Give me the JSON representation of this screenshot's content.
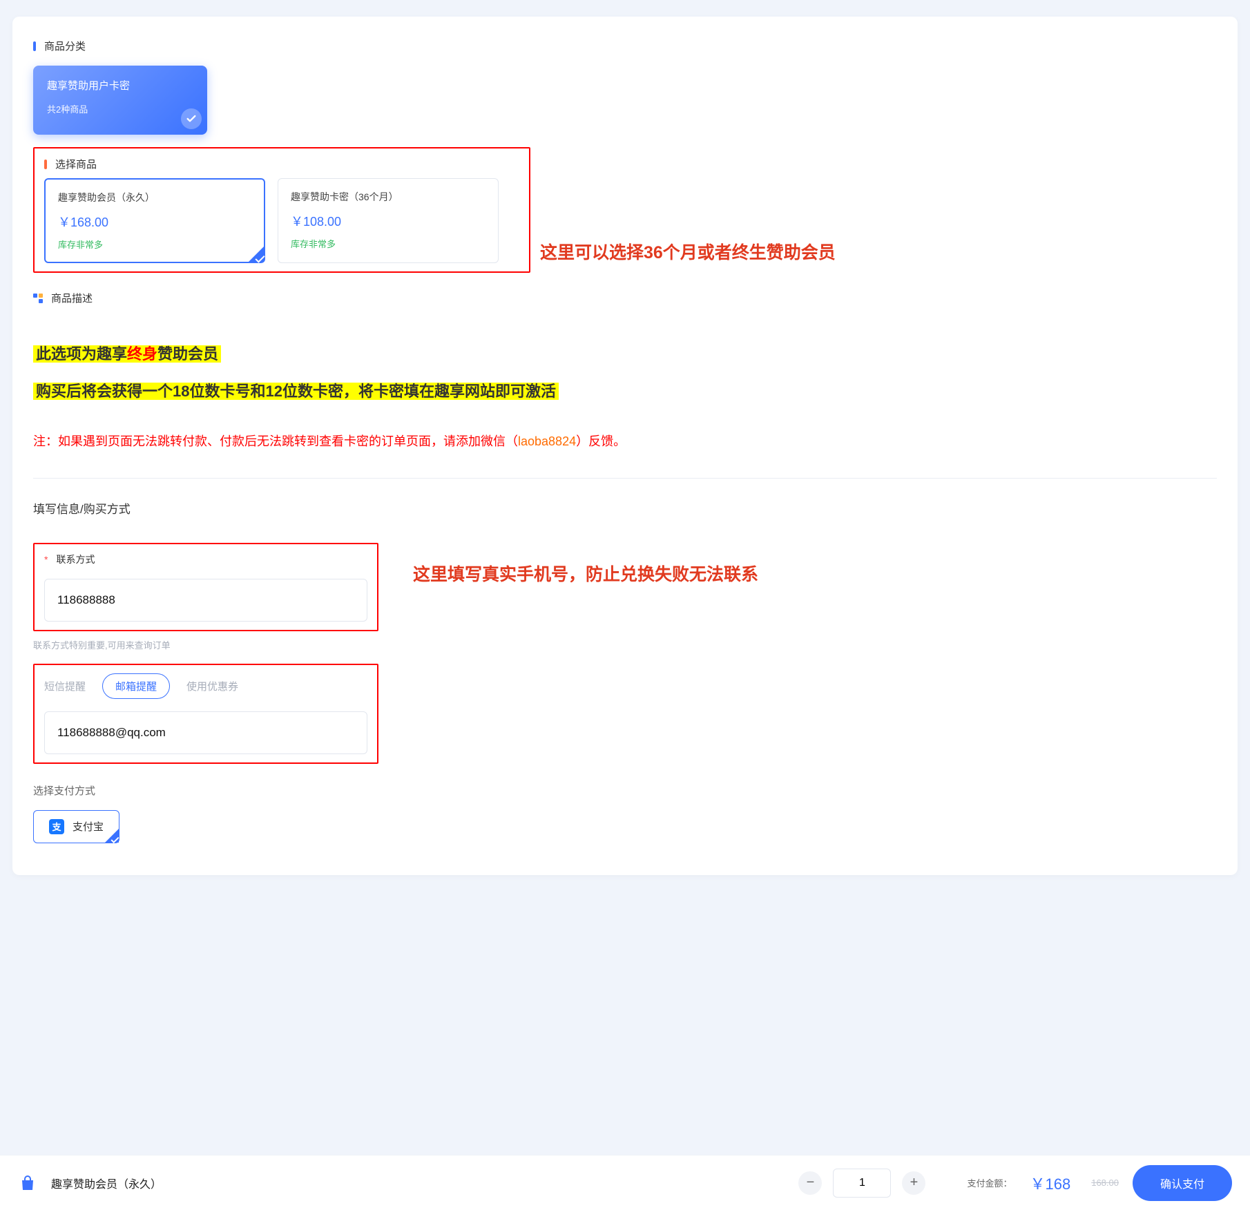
{
  "section_category_label": "商品分类",
  "category": {
    "title": "趣享赞助用户卡密",
    "sub": "共2种商品"
  },
  "section_select_label": "选择商品",
  "products": [
    {
      "name": "趣享赞助会员（永久）",
      "price": "￥168.00",
      "stock": "库存非常多",
      "selected": true
    },
    {
      "name": "趣享赞助卡密（36个月）",
      "price": "￥108.00",
      "stock": "库存非常多",
      "selected": false
    }
  ],
  "annot_select": "这里可以选择36个月或者终生赞助会员",
  "section_desc_label": "商品描述",
  "desc_line1_pre": "此选项为趣享",
  "desc_line1_mid": "终身",
  "desc_line1_post": "赞助会员",
  "desc_line2": "购买后将会获得一个18位数卡号和12位数卡密，将卡密填在趣享网站即可激活",
  "note_pre": "注：如果遇到页面无法跳转付款、付款后无法跳转到查看卡密的订单页面，请添加微信（",
  "note_wechat": "laoba8824",
  "note_post": "）反馈。",
  "section_fill_label": "填写信息/购买方式",
  "contact_label": "联系方式",
  "contact_value": "118688888",
  "contact_helper": "联系方式特别重要,可用来查询订单",
  "chip_sms": "短信提醒",
  "chip_email": "邮箱提醒",
  "chip_coupon": "使用优惠券",
  "email_value": "118688888@qq.com",
  "annot_contact": "这里填写真实手机号，防止兑换失败无法联系",
  "pay_method_label": "选择支付方式",
  "alipay_label": "支付宝",
  "bottom": {
    "product_name": "趣享赞助会员（永久）",
    "qty": "1",
    "amount_label": "支付金额：",
    "amount": "￥168",
    "orig": "168.00",
    "confirm": "确认支付"
  }
}
